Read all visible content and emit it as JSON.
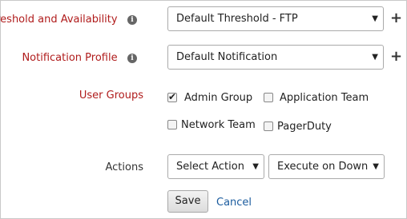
{
  "threshold": {
    "label": "Threshold and Availability",
    "info": "i",
    "selected": "Default Threshold - FTP",
    "caret": "▼",
    "add": "+"
  },
  "notification": {
    "label": "Notification Profile",
    "info": "i",
    "selected": "Default Notification",
    "caret": "▼",
    "add": "+"
  },
  "user_groups": {
    "label": "User Groups",
    "items": [
      {
        "label": "Admin Group",
        "checked": true
      },
      {
        "label": "Application Team",
        "checked": false
      },
      {
        "label": "Network Team",
        "checked": false
      },
      {
        "label": "PagerDuty",
        "checked": false
      }
    ]
  },
  "actions": {
    "label": "Actions",
    "action_select": "Select Action",
    "trigger_select": "Execute on Down",
    "caret": "▼"
  },
  "buttons": {
    "save": "Save",
    "cancel": "Cancel"
  },
  "colors": {
    "required_label": "#b01c1c",
    "link": "#1a5b9e"
  }
}
